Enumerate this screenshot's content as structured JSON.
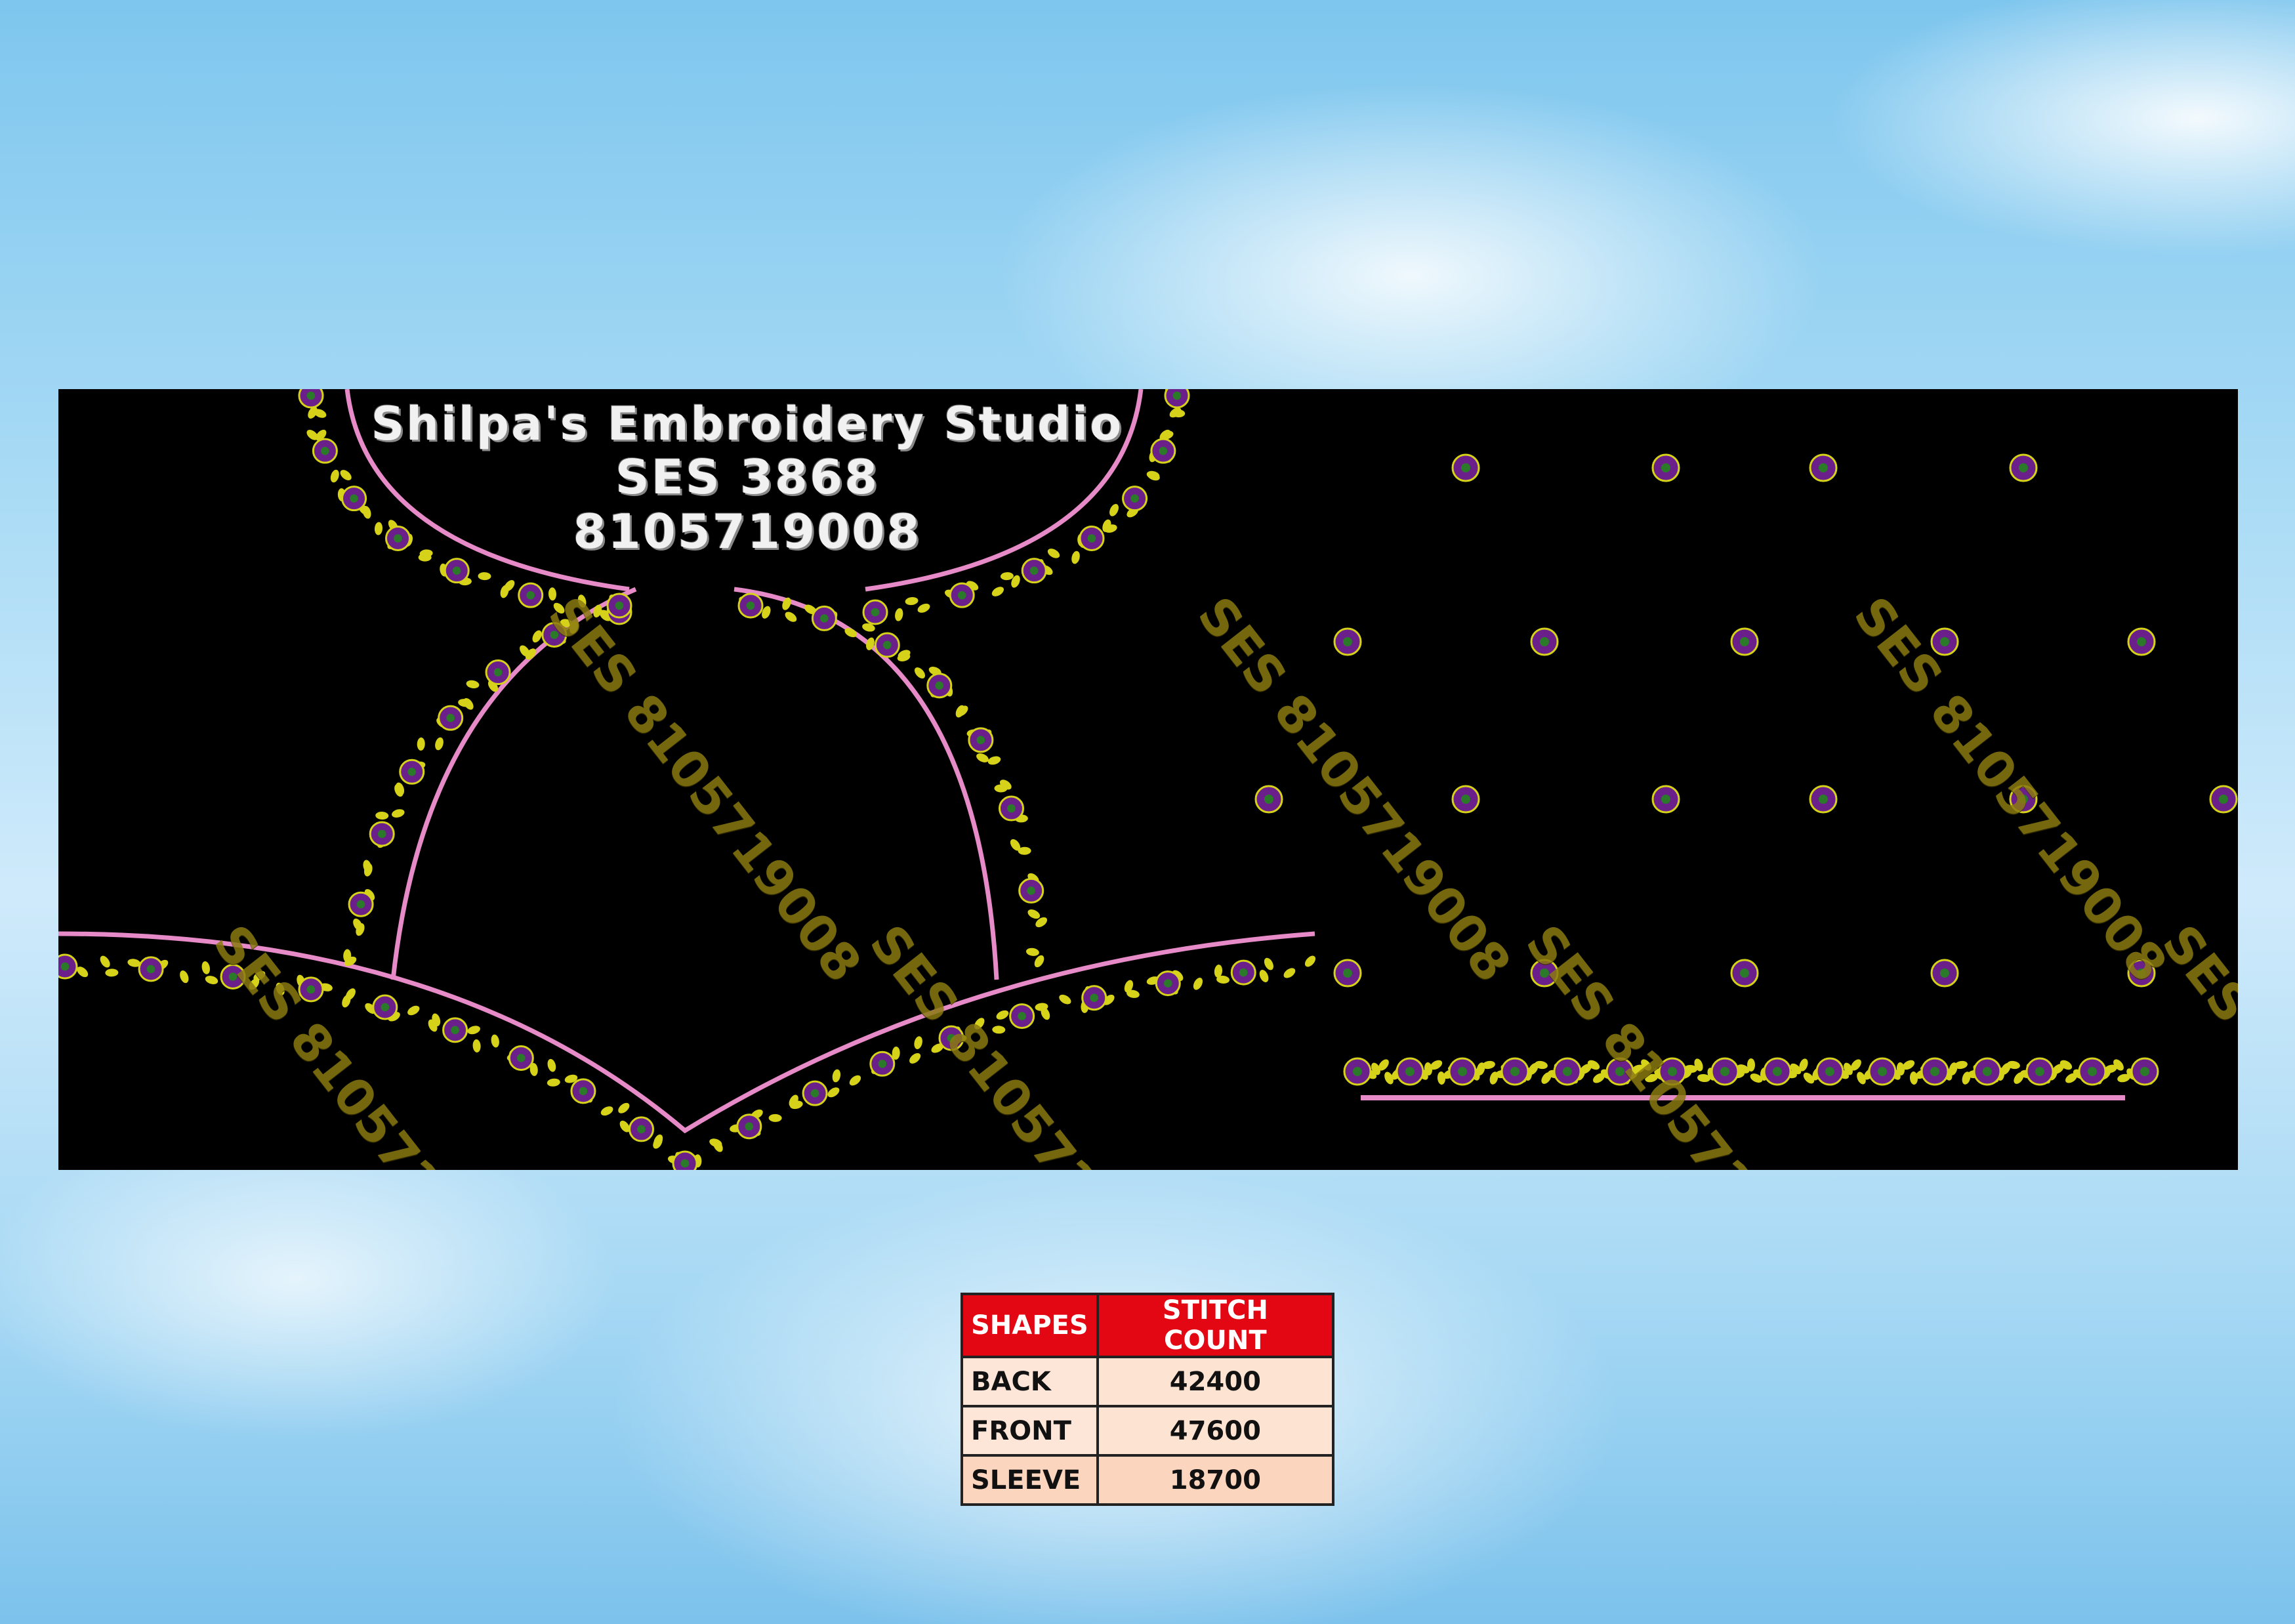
{
  "studio": {
    "name": "Shilpa's Embroidery Studio",
    "code": "SES 3868",
    "phone": "8105719008"
  },
  "watermark_text": "SES 8105719008",
  "table": {
    "headers": [
      "SHAPES",
      "STITCH COUNT"
    ],
    "rows": [
      {
        "shape": "BACK",
        "count": "42400"
      },
      {
        "shape": "FRONT",
        "count": "47600"
      },
      {
        "shape": "SLEEVE",
        "count": "18700"
      }
    ]
  },
  "colors": {
    "background_sky": "#a9dbf5",
    "panel": "#000000",
    "outline_pink": "#e68ac8",
    "vine_yellow": "#d6d21a",
    "flower_purple": "#6a1f8a",
    "watermark": "#8a7a10",
    "table_header": "#e30613",
    "table_cell": "#fde3d2"
  }
}
